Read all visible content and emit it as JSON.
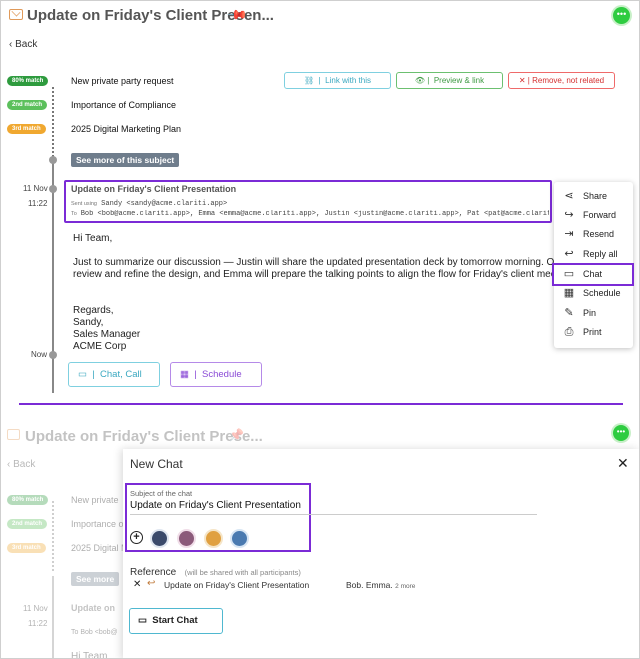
{
  "top": {
    "title": "Update on Friday's Client Presen...",
    "back_label": "Back",
    "matches": [
      {
        "badge": "80% match",
        "subject": "New private party request",
        "color": "#2e9b3e"
      },
      {
        "badge": "2nd match",
        "subject": "Importance of Compliance",
        "color": "#5cc05c"
      },
      {
        "badge": "3rd match",
        "subject": "2025 Digital Marketing Plan",
        "color": "#f0a830"
      }
    ],
    "actions": {
      "link": "Link with this",
      "preview": "Preview & link",
      "remove": "Remove, not related"
    },
    "see_more": "See more of this subject",
    "date": "11 Nov",
    "time": "11:22",
    "now": "Now",
    "email": {
      "subject": "Update on Friday's Client Presentation",
      "sent_using_label": "Sent using",
      "sender": "Sandy <sandy@acme.clariti.app>",
      "to_label": "To",
      "recipients": "Bob <bob@acme.clariti.app>, Emma <emma@acme.clariti.app>, Justin <justin@acme.clariti.app>, Pat <pat@acme.clariti.app>",
      "greeting": "Hi Team,",
      "body_line1": "Just to summarize our discussion — Justin will share the updated presentation deck by tomorrow morning. Once",
      "body_line2": "review and refine the design, and Emma will prepare the talking points to align the flow for Friday's client meeting",
      "sign1": "Regards,",
      "sign2": "Sandy,",
      "sign3": "Sales Manager",
      "sign4": "ACME Corp"
    },
    "chat_call": "Chat, Call",
    "schedule": "Schedule",
    "menu": [
      {
        "label": "Share",
        "icon": "share-icon"
      },
      {
        "label": "Forward",
        "icon": "forward-icon"
      },
      {
        "label": "Resend",
        "icon": "resend-icon"
      },
      {
        "label": "Reply all",
        "icon": "reply-all-icon"
      },
      {
        "label": "Chat",
        "icon": "chat-icon"
      },
      {
        "label": "Schedule",
        "icon": "calendar-icon"
      },
      {
        "label": "Pin",
        "icon": "pin-icon"
      },
      {
        "label": "Print",
        "icon": "print-icon"
      }
    ]
  },
  "bottom": {
    "title": "Update on Friday's Client Prese...",
    "back_label": "Back",
    "matches": [
      {
        "badge": "80% match",
        "subject": "New private"
      },
      {
        "badge": "2nd match",
        "subject": "Importance of"
      },
      {
        "badge": "3rd match",
        "subject": "2025 Digital M"
      }
    ],
    "see_more": "See more",
    "date": "11 Nov",
    "time": "11:22",
    "subject_partial": "Update on",
    "to_partial": "To  Bob <bob@",
    "greeting_partial": "Hi Team"
  },
  "modal": {
    "title": "New Chat",
    "subject_label": "Subject of the chat",
    "subject_value": "Update on Friday's Client Presentation",
    "reference_label": "Reference",
    "reference_note": "(will be shared with all participants)",
    "reference_item": "Update on Friday's Client Presentation",
    "reference_people": "Bob. Emma.",
    "reference_more": "2 more",
    "start_chat": "Start Chat"
  },
  "colors": {
    "highlight": "#7b2bd6",
    "teal": "#4fb8d0",
    "green": "#4caf50",
    "red": "#e53935",
    "badge_green": "#2e9b3e",
    "status": "#2ecc40"
  }
}
